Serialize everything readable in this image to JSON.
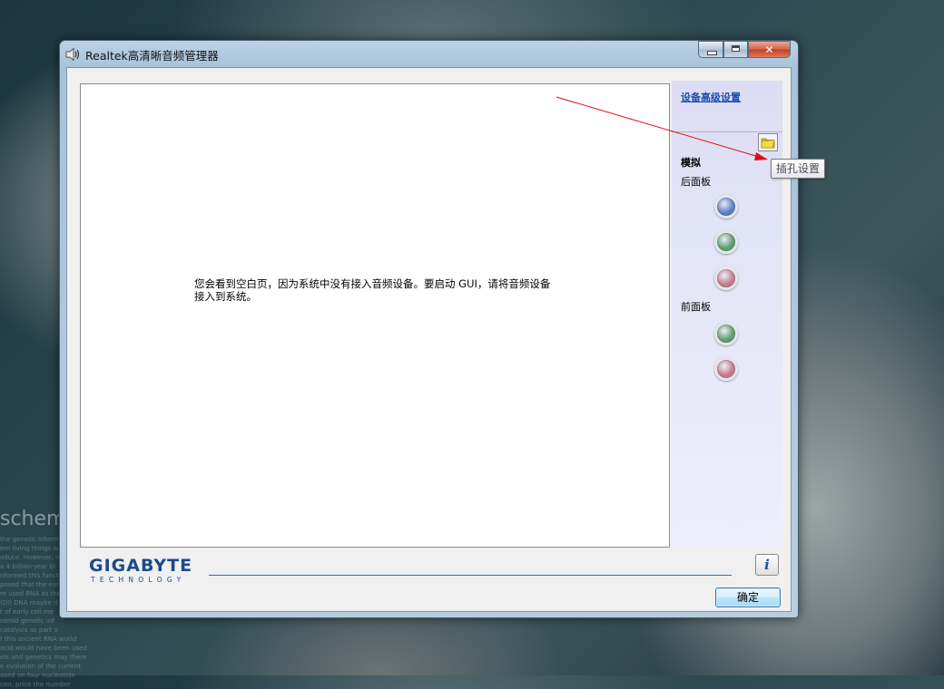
{
  "desktop": {
    "brand_text": "schem",
    "small_lines": [
      "the genetic inform",
      "ern living things w",
      "oduce. However, it",
      "a 4-billion-year bi",
      "nformed this functi",
      "posed that the earl",
      "re used RNA as the",
      "(DI) DNA maybe d",
      "t of early cell me",
      "ntmid genetic inf",
      "catalysis as part o",
      "f this ancient RNA world",
      "acid would have been used",
      "els and genetics may there",
      "e evolution of the current",
      "ased on four nucleotide",
      "cen, price the number"
    ]
  },
  "window": {
    "title": "Realtek高清晰音频管理器",
    "message": "您会看到空白页，因为系统中没有接入音频设备。要启动 GUI，请将音频设备接入到系统。",
    "side": {
      "advanced_link": "设备高级设置",
      "analog_label": "模拟",
      "back_panel_label": "后面板",
      "front_panel_label": "前面板",
      "back_jacks": [
        "#5b7fc8",
        "#5f9e6e",
        "#c47c8e"
      ],
      "front_jacks": [
        "#5f9e6e",
        "#c47c8e"
      ]
    },
    "logo": {
      "main": "GIGABYTE",
      "sub": "TECHNOLOGY"
    },
    "info_glyph": "i",
    "ok_label": "确定",
    "close_glyph": "✕"
  },
  "tooltip": {
    "text": "插孔设置"
  },
  "colors": {
    "arrow": "#e01010",
    "link": "#1a4fb0",
    "logo": "#1b4a8c",
    "folder": "#f2c81e"
  }
}
